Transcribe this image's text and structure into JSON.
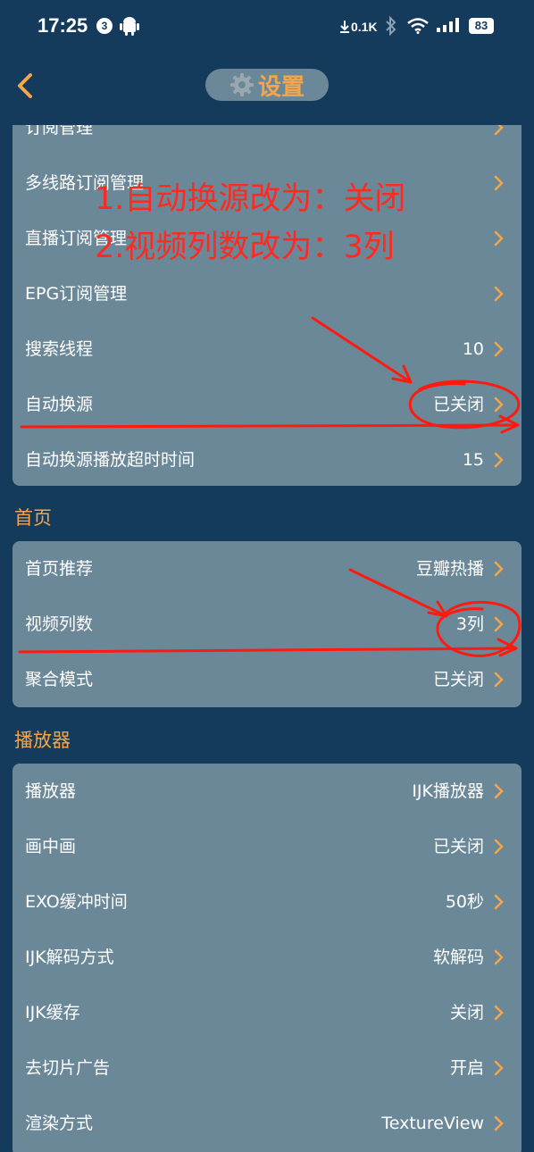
{
  "status_bar": {
    "time": "17:25",
    "notification_count": "3",
    "net_speed": "0.1K",
    "battery": "83"
  },
  "header": {
    "title": "设置"
  },
  "annotation": {
    "line1": "1.自动换源改为：关闭",
    "line2": "2.视频列数改为：3列"
  },
  "subscription_card": {
    "rows": [
      {
        "label": "订阅管理",
        "value": ""
      },
      {
        "label": "多线路订阅管理",
        "value": ""
      },
      {
        "label": "直播订阅管理",
        "value": ""
      },
      {
        "label": "EPG订阅管理",
        "value": ""
      },
      {
        "label": "搜索线程",
        "value": "10"
      },
      {
        "label": "自动换源",
        "value": "已关闭"
      },
      {
        "label": "自动换源播放超时时间",
        "value": "15"
      }
    ]
  },
  "home_section": {
    "title": "首页",
    "rows": [
      {
        "label": "首页推荐",
        "value": "豆瓣热播"
      },
      {
        "label": "视频列数",
        "value": "3列"
      },
      {
        "label": "聚合模式",
        "value": "已关闭"
      }
    ]
  },
  "player_section": {
    "title": "播放器",
    "rows": [
      {
        "label": "播放器",
        "value": "IJK播放器"
      },
      {
        "label": "画中画",
        "value": "已关闭"
      },
      {
        "label": "EXO缓冲时间",
        "value": "50秒"
      },
      {
        "label": "IJK解码方式",
        "value": "软解码"
      },
      {
        "label": "IJK缓存",
        "value": "关闭"
      },
      {
        "label": "去切片广告",
        "value": "开启"
      },
      {
        "label": "渲染方式",
        "value": "TextureView"
      }
    ]
  },
  "colors": {
    "background": "#143a5c",
    "card": "#6b8899",
    "accent": "#f5a54a",
    "annotation": "#ff2a1f"
  }
}
